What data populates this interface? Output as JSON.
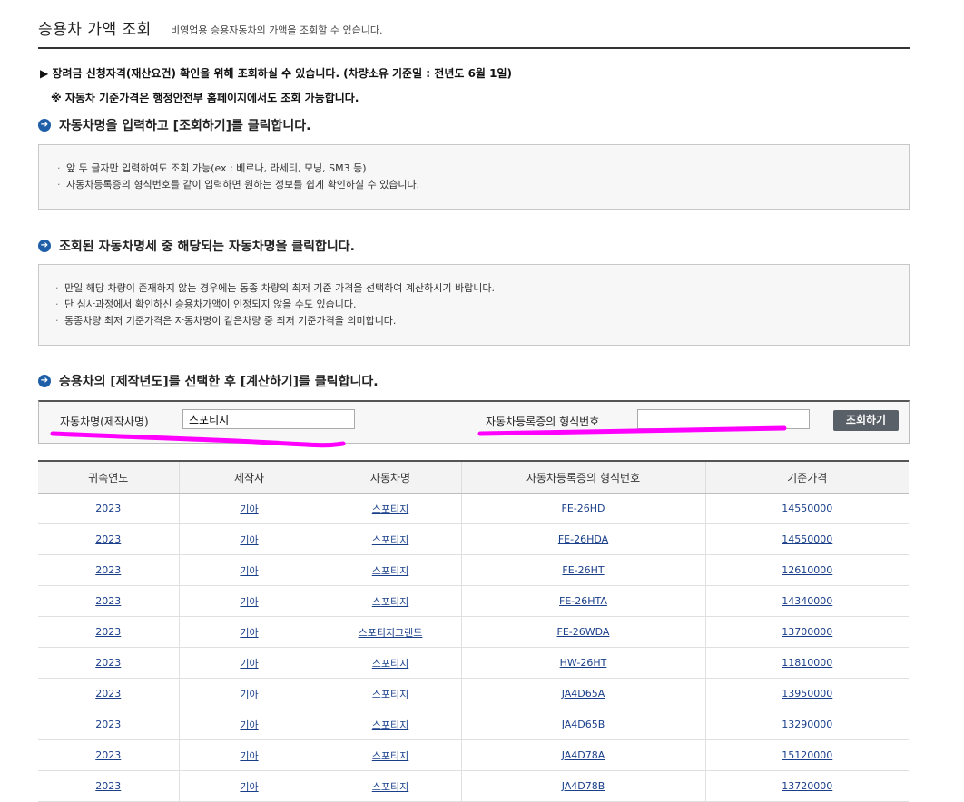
{
  "header": {
    "title": "승용차 가액 조회",
    "subtitle": "비영업용 승용자동차의 가액을 조회할 수 있습니다."
  },
  "notices": {
    "line1": "▶ 장려금 신청자격(재산요건) 확인을 위해 조회하실 수 있습니다. (차량소유 기준일 : 전년도 6월 1일)",
    "line2": "※ 자동차 기준가격은 행정안전부 홈페이지에서도 조회 가능합니다."
  },
  "steps": [
    {
      "title": "자동차명을 입력하고 [조회하기]를 클릭합니다.",
      "items": [
        "앞 두 글자만 입력하여도 조회 가능(ex : 베르나, 라세티, 모닝, SM3 등)",
        "자동차등록증의 형식번호를 같이 입력하면 원하는 정보를 쉽게 확인하실 수 있습니다."
      ]
    },
    {
      "title": "조회된 자동차명세 중 해당되는 자동차명을 클릭합니다.",
      "items": [
        "만일 해당 차량이 존재하지 않는 경우에는 동종 차량의 최저 기준 가격을 선택하여 계산하시기 바랍니다.",
        "단 심사과정에서 확인하신 승용차가액이 인정되지 않을 수도 있습니다.",
        "동종차량 최저 기준가격은 자동차명이 같은차량 중  최저 기준가격을 의미합니다."
      ]
    },
    {
      "title": "승용차의 [제작년도]를 선택한 후 [계산하기]를 클릭합니다."
    }
  ],
  "search": {
    "car_name_label": "자동차명(제작사명)",
    "car_name_value": "스포티지",
    "model_no_label": "자동차등록증의 형식번호",
    "model_no_value": "",
    "button_label": "조회하기"
  },
  "table": {
    "headers": [
      "귀속연도",
      "제작사",
      "자동차명",
      "자동차등록증의 형식번호",
      "기준가격"
    ],
    "rows": [
      [
        "2023",
        "기아",
        "스포티지",
        "FE-26HD",
        "14550000"
      ],
      [
        "2023",
        "기아",
        "스포티지",
        "FE-26HDA",
        "14550000"
      ],
      [
        "2023",
        "기아",
        "스포티지",
        "FE-26HT",
        "12610000"
      ],
      [
        "2023",
        "기아",
        "스포티지",
        "FE-26HTA",
        "14340000"
      ],
      [
        "2023",
        "기아",
        "스포티지그랜드",
        "FE-26WDA",
        "13700000"
      ],
      [
        "2023",
        "기아",
        "스포티지",
        "HW-26HT",
        "11810000"
      ],
      [
        "2023",
        "기아",
        "스포티지",
        "JA4D65A",
        "13950000"
      ],
      [
        "2023",
        "기아",
        "스포티지",
        "JA4D65B",
        "13290000"
      ],
      [
        "2023",
        "기아",
        "스포티지",
        "JA4D78A",
        "15120000"
      ],
      [
        "2023",
        "기아",
        "스포티지",
        "JA4D78B",
        "13720000"
      ]
    ]
  },
  "colors": {
    "accent": "#1f5fa8",
    "highlight": "#ff00ff",
    "button": "#5a6068",
    "link": "#1a3f8a"
  },
  "icons": {
    "step_marker": "arrow-circle-icon"
  }
}
